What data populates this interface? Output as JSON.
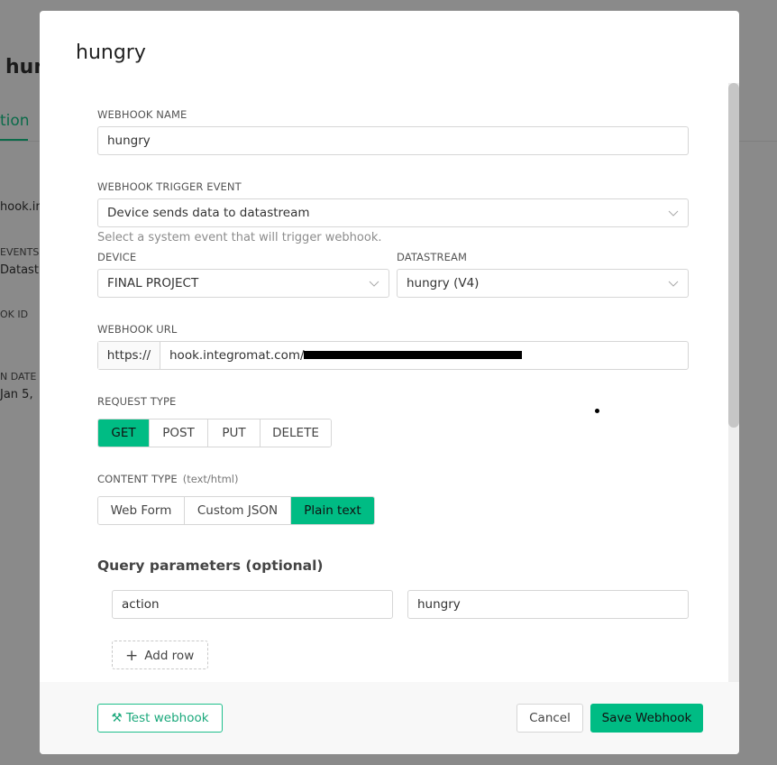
{
  "background": {
    "title_fragment": "hun",
    "tab_fragment": "tion",
    "items": [
      {
        "label": "",
        "value": "hook.in"
      },
      {
        "label": "EVENTS",
        "value": "Datastr"
      },
      {
        "label": "OK ID",
        "value": ""
      },
      {
        "label": "N DATE",
        "value": "Jan 5,"
      }
    ]
  },
  "modal": {
    "title": "hungry",
    "webhook_name": {
      "label": "WEBHOOK NAME",
      "value": "hungry"
    },
    "trigger_event": {
      "label": "WEBHOOK TRIGGER EVENT",
      "value": "Device sends data to datastream",
      "helper": "Select a system event that will trigger webhook."
    },
    "device": {
      "label": "DEVICE",
      "value": "FINAL PROJECT"
    },
    "datastream": {
      "label": "DATASTREAM",
      "value": "hungry (V4)"
    },
    "webhook_url": {
      "label": "WEBHOOK URL",
      "prefix": "https://",
      "value": "hook.integromat.com/",
      "redacted": true
    },
    "request_type": {
      "label": "REQUEST TYPE",
      "options": [
        "GET",
        "POST",
        "PUT",
        "DELETE"
      ],
      "selected": "GET"
    },
    "content_type": {
      "label": "CONTENT TYPE",
      "hint": "(text/html)",
      "options": [
        "Web Form",
        "Custom JSON",
        "Plain text"
      ],
      "selected": "Plain text"
    },
    "query_params": {
      "title": "Query parameters (optional)",
      "rows": [
        {
          "key": "action",
          "value": "hungry"
        }
      ],
      "add_row_label": "Add row"
    },
    "footer": {
      "test_label": "Test webhook",
      "cancel_label": "Cancel",
      "save_label": "Save Webhook"
    }
  },
  "colors": {
    "accent": "#00bc84",
    "accent_text": "#1aa87b",
    "overlay": "#8a8a8a"
  }
}
